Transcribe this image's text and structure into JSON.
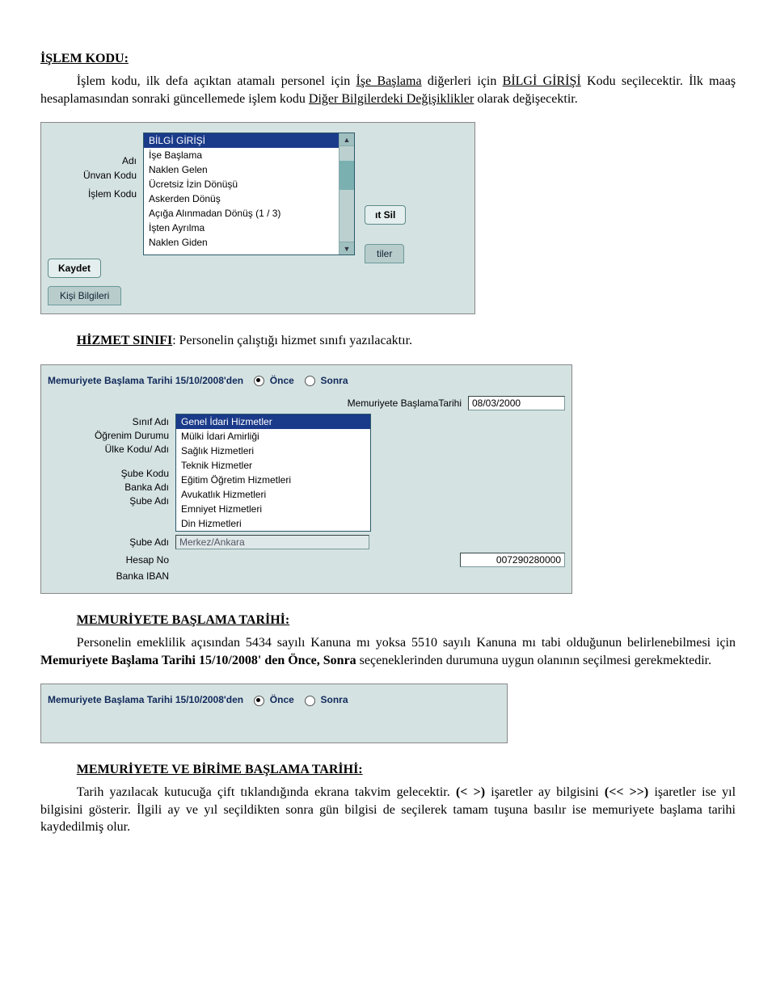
{
  "sec1": {
    "title": "İŞLEM KODU:",
    "p_start": "İşlem kodu, ilk defa açıktan atamalı personel için ",
    "p_bold1": "İşe Başlama",
    "p_mid1": " diğerleri için ",
    "p_bold2": "BİLGİ GİRİŞİ",
    "p_mid2": " Kodu seçilecektir. İlk maaş hesaplamasından sonraki güncellemede işlem kodu ",
    "p_bold3": "Diğer Bilgilerdeki Değişiklikler",
    "p_end": " olarak değişecektir."
  },
  "shot1": {
    "labels": {
      "islem_kodu": "İşlem Kodu",
      "adi": "Adı",
      "unvan_kodu": "Ünvan Kodu"
    },
    "options": [
      "BİLGİ GİRİŞİ",
      "İşe Başlama",
      "Naklen Gelen",
      "Ücretsiz İzin Dönüşü",
      "Askerden Dönüş",
      "Açığa Alınmadan Dönüş (1 / 3)",
      "İşten Ayrılma",
      "Naklen Giden"
    ],
    "buttons": {
      "kaydet": "Kaydet",
      "sil": "ıt Sil"
    },
    "tabs": {
      "kisi": "Kişi Bilgileri",
      "other": "tiler"
    }
  },
  "sec2": {
    "title": "HİZMET SINIFI",
    "tail": ": Personelin çalıştığı hizmet sınıfı yazılacaktır."
  },
  "shot2": {
    "headerPrefix": "Memuriyete Başlama Tarihi 15/10/2008'den",
    "once": "Önce",
    "sonra": "Sonra",
    "mbt_label": "Memuriyete BaşlamaTarihi",
    "mbt_value": "08/03/2000",
    "labels": {
      "sinif": "Sınıf Adı",
      "ogrenim": "Öğrenim Durumu",
      "ulke": "Ülke Kodu/ Adı",
      "sube_kodu": "Şube Kodu",
      "banka_adi": "Banka Adı",
      "sube_adi": "Şube Adı",
      "hesap_no": "Hesap No",
      "iban": "Banka IBAN"
    },
    "options": [
      "Genel İdari Hizmetler",
      "Mülki İdari Amirliği",
      "Sağlık Hizmetleri",
      "Teknik Hizmetler",
      "Eğitim Öğretim Hizmetleri",
      "Avukatlık Hizmetleri",
      "Emniyet Hizmetleri",
      "Din Hizmetleri"
    ],
    "sube_adi_val": "Merkez/Ankara",
    "hesap_no_val": "007290280000"
  },
  "sec3": {
    "title": "MEMURİYETE BAŞLAMA TARİHİ:",
    "p_a": "Personelin emeklilik açısından 5434 sayılı Kanuna mı yoksa 5510 sayılı Kanuna mı tabi olduğunun belirlenebilmesi için ",
    "p_b": "Memuriyete Başlama Tarihi 15/10/2008' den Önce, Sonra",
    "p_c": " seçeneklerinden durumuna uygun olanının seçilmesi gerekmektedir."
  },
  "shot3": {
    "headerPrefix": "Memuriyete Başlama Tarihi 15/10/2008'den",
    "once": "Önce",
    "sonra": "Sonra"
  },
  "sec4": {
    "title": "MEMURİYETE VE BİRİME BAŞLAMA TARİHİ:",
    "p_a": "Tarih yazılacak kutucuğa çift tıklandığında ekrana takvim gelecektir. ",
    "p_b": "(< >)",
    "p_c": " işaretler ay bilgisini ",
    "p_d": "(<< >>)",
    "p_e": "işaretler ise yıl bilgisini gösterir. İlgili ay ve yıl seçildikten sonra gün bilgisi de seçilerek tamam tuşuna basılır ise memuriyete başlama tarihi kaydedilmiş olur."
  }
}
